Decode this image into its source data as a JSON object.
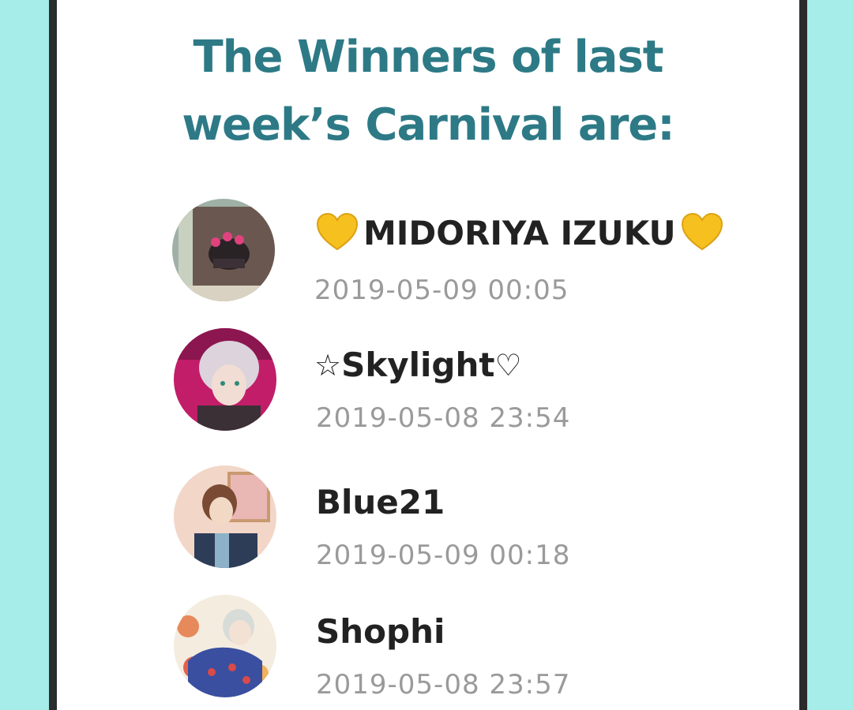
{
  "page": {
    "title": "The Winners of last\nweek’s Carnival are:"
  },
  "winners": [
    {
      "name": "MIDORIYA IZUKU",
      "time": "2019-05-09 00:05",
      "decoration": "yellow-heart-icon"
    },
    {
      "name": "Skylight",
      "prefix_glyph": "☆",
      "suffix_glyph": "♡",
      "time": "2019-05-08 23:54"
    },
    {
      "name": "Blue21",
      "time": "2019-05-09 00:18"
    },
    {
      "name": "Shophi",
      "time": "2019-05-08 23:57"
    }
  ],
  "colors": {
    "background": "#a6ece9",
    "title": "#2d7a86",
    "name": "#222222",
    "timestamp": "#9a9a9a",
    "heart": "#f6c01e"
  }
}
